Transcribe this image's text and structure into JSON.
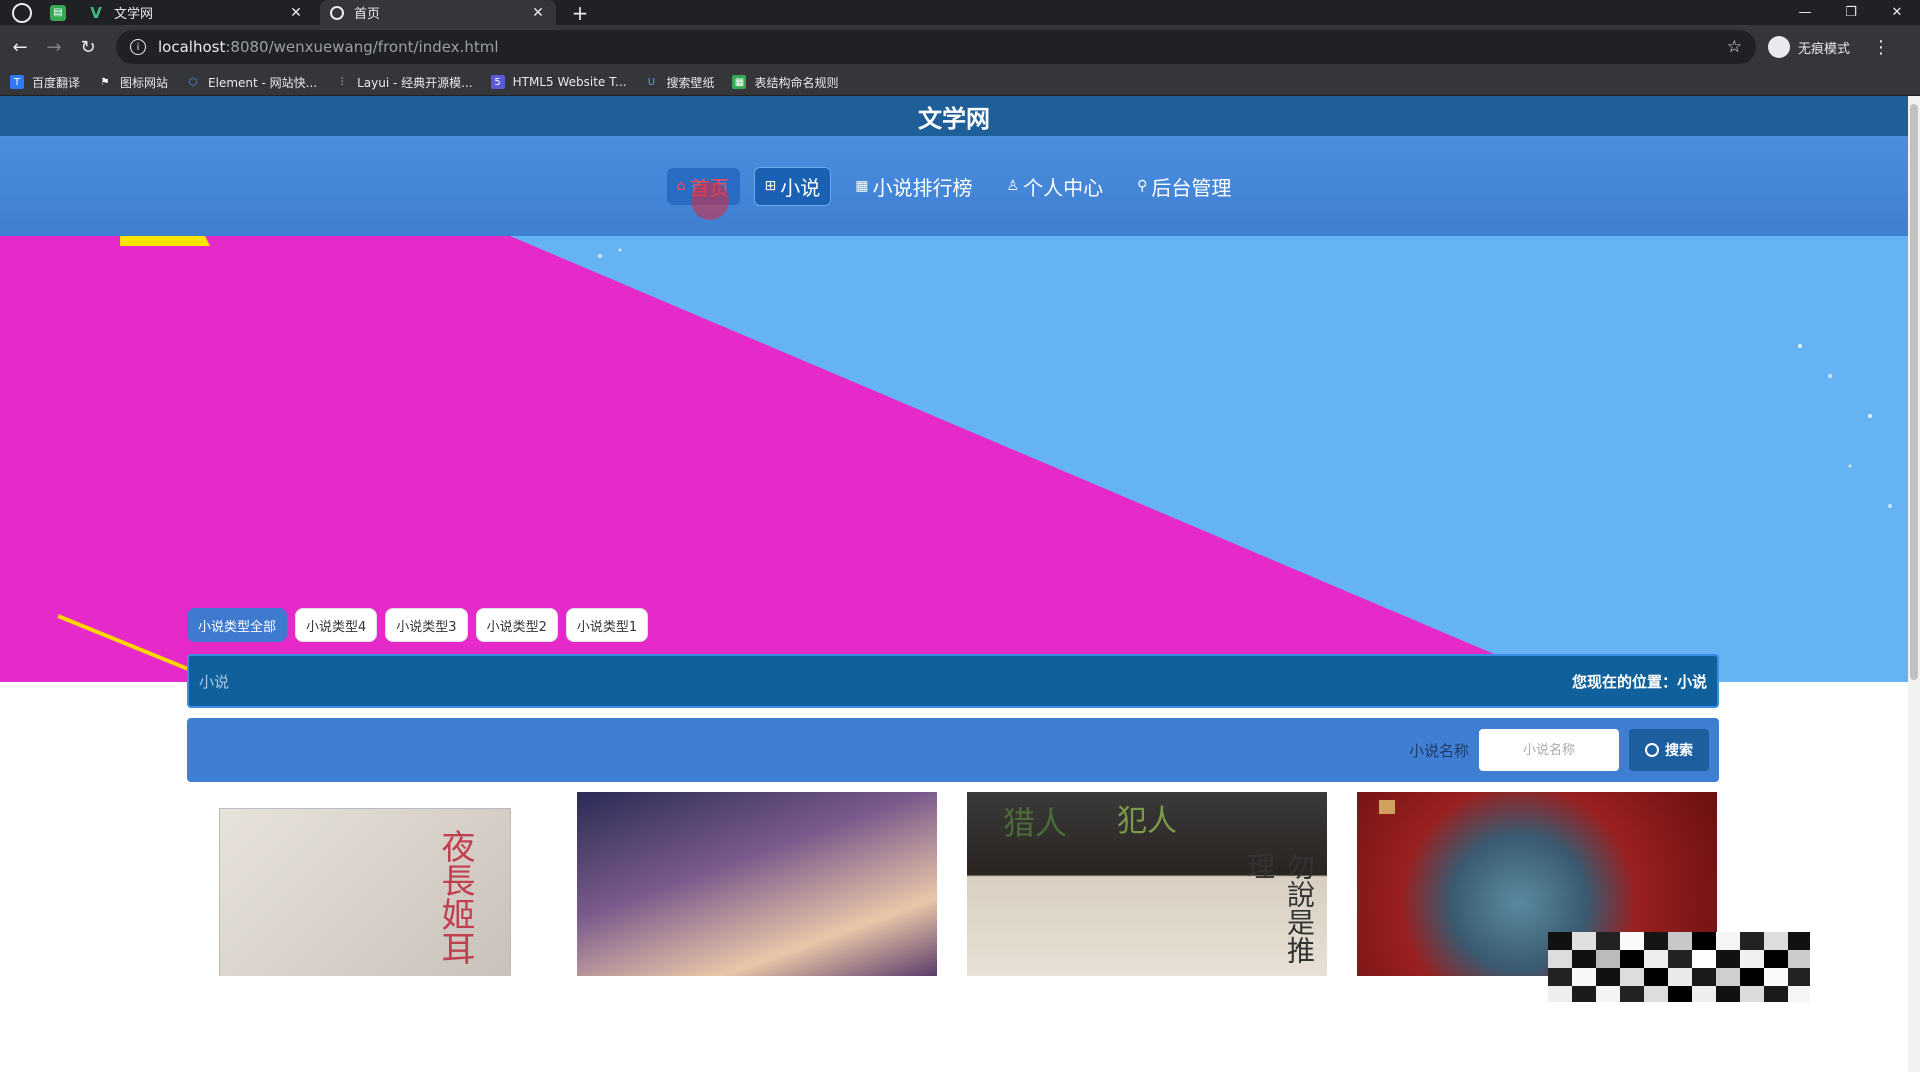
{
  "browser": {
    "tabs": [
      {
        "title": "文学网",
        "active": false
      },
      {
        "title": "首页",
        "active": true
      }
    ],
    "url_host": "localhost",
    "url_path": ":8080/wenxuewang/front/index.html",
    "profile_label": "无痕模式",
    "bookmarks": [
      {
        "label": "百度翻译",
        "icon": "translate-icon",
        "color": "#2d7cf6"
      },
      {
        "label": "图标网站",
        "icon": "flag-icon",
        "color": "#555555"
      },
      {
        "label": "Element - 网站快...",
        "icon": "element-icon",
        "color": "#409eff"
      },
      {
        "label": "Layui - 经典开源模...",
        "icon": "layui-icon",
        "color": "#777777"
      },
      {
        "label": "HTML5 Website T...",
        "icon": "html5-icon",
        "color": "#5a5ad6"
      },
      {
        "label": "搜索壁纸",
        "icon": "wallpaper-icon",
        "color": "#3b6bd6"
      },
      {
        "label": "表结构命名规则",
        "icon": "sheet-icon",
        "color": "#34a853"
      }
    ]
  },
  "site": {
    "title": "文学网",
    "nav": [
      {
        "label": "首页",
        "icon": "home-icon",
        "glyph": "⌂"
      },
      {
        "label": "小说",
        "icon": "grid-icon",
        "glyph": "⊞"
      },
      {
        "label": "小说排行榜",
        "icon": "calendar-icon",
        "glyph": "▦"
      },
      {
        "label": "个人中心",
        "icon": "user-icon",
        "glyph": "♙"
      },
      {
        "label": "后台管理",
        "icon": "link-icon",
        "glyph": "⚲"
      }
    ]
  },
  "categories": [
    "小说类型全部",
    "小说类型4",
    "小说类型3",
    "小说类型2",
    "小说类型1"
  ],
  "location_bar": {
    "section": "小说",
    "location": "您现在的位置：小说"
  },
  "search": {
    "label": "小说名称",
    "placeholder": "小说名称",
    "button": "搜索"
  },
  "covers": {
    "c1_title": "夜長姬耳",
    "c3_title_a": "猎人",
    "c3_title_b": "犯人",
    "c3_vertical": "勿說是推理"
  },
  "colors": {
    "title_bar": "#1f5f99",
    "nav_bg": "#4a8ee0",
    "accent": "#3d7ad0",
    "banner_magenta": "#e629c9",
    "banner_blue": "#66b3f3"
  }
}
